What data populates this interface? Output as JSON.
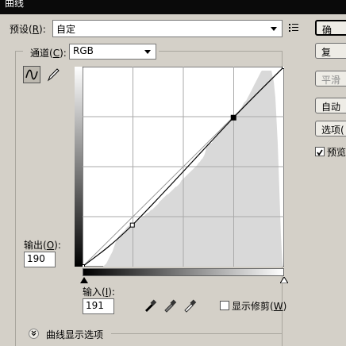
{
  "window": {
    "title": "曲线"
  },
  "preset": {
    "label": "预设(",
    "key": "R",
    "label_end": "):",
    "value": "自定"
  },
  "channel": {
    "label": "通道(",
    "key": "C",
    "label_end": "):",
    "value": "RGB"
  },
  "buttons": {
    "ok": "确",
    "reset": "复",
    "smooth": "平滑",
    "auto": "自动",
    "options": "选项("
  },
  "preview": {
    "label": "预览",
    "checked": true
  },
  "output": {
    "label": "输出(",
    "key": "O",
    "label_end": "):",
    "value": "190"
  },
  "input": {
    "label": "输入(",
    "key": "I",
    "label_end": "):",
    "value": "191"
  },
  "show_clipping": {
    "label": "显示修剪(",
    "key": "W",
    "label_end": ")",
    "checked": false
  },
  "curve_display_options": {
    "label": "曲线显示选项"
  },
  "curve_points": [
    [
      0,
      0
    ],
    [
      63,
      53
    ],
    [
      191,
      190
    ],
    [
      255,
      255
    ]
  ],
  "histogram": [
    0,
    0,
    0,
    0,
    0,
    0,
    0,
    0,
    0,
    0,
    0,
    0,
    0,
    0,
    0,
    0,
    0,
    0,
    0,
    0,
    0,
    0,
    0,
    0,
    0,
    0,
    0,
    1,
    2,
    3,
    4,
    6,
    8,
    10,
    12,
    14,
    16,
    18,
    20,
    23,
    26,
    29,
    32,
    34,
    36,
    38,
    40,
    41,
    42,
    43,
    44,
    45,
    46,
    47,
    48,
    50,
    51,
    52,
    53,
    53,
    54,
    55,
    55,
    56,
    56,
    57,
    57,
    58,
    58,
    59,
    60,
    61,
    62,
    62,
    63,
    64,
    65,
    66,
    66,
    67,
    68,
    69,
    70,
    70,
    71,
    72,
    73,
    74,
    74,
    75,
    76,
    77,
    78,
    79,
    80,
    81,
    82,
    84,
    85,
    86,
    87,
    88,
    89,
    90,
    91,
    92,
    93,
    94,
    94,
    95,
    96,
    97,
    98,
    99,
    100,
    101,
    102,
    103,
    104,
    104,
    105,
    106,
    107,
    108,
    110,
    112,
    113,
    114,
    115,
    116,
    117,
    118,
    119,
    120,
    121,
    122,
    123,
    124,
    125,
    126,
    127,
    128,
    129,
    130,
    131,
    132,
    134,
    135,
    136,
    137,
    139,
    140,
    141,
    143,
    145,
    148,
    152,
    156,
    160,
    160,
    160,
    160,
    160,
    161,
    162,
    164,
    165,
    167,
    169,
    170,
    172,
    174,
    175,
    177,
    178,
    180,
    181,
    182,
    183,
    184,
    185,
    186,
    187,
    188,
    189,
    190,
    191,
    192,
    193,
    194,
    195,
    196,
    197,
    198,
    199,
    200,
    201,
    202,
    203,
    204,
    205,
    207,
    209,
    211,
    213,
    214,
    215,
    216,
    218,
    220,
    222,
    224,
    226,
    228,
    230,
    232,
    234,
    236,
    238,
    240,
    242,
    244,
    246,
    248,
    250,
    252,
    254,
    255,
    255,
    255,
    255,
    255,
    255,
    255,
    255,
    255,
    255,
    255,
    255,
    255,
    250,
    245,
    240,
    230,
    220,
    200,
    180,
    160,
    130,
    100,
    70,
    40,
    20,
    5,
    0,
    0,
    0,
    0,
    0,
    0,
    0,
    0,
    0,
    0,
    0,
    0,
    0,
    0
  ]
}
